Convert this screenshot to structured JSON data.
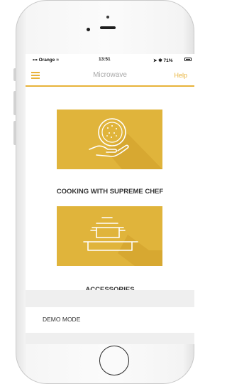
{
  "status_bar": {
    "carrier": "Orange",
    "time": "13:51",
    "battery": "71%"
  },
  "nav": {
    "title": "Microwave",
    "help_label": "Help"
  },
  "menu": {
    "items": [
      {
        "label": "COOKING WITH SUPREME CHEF",
        "icon": "plate-hand-icon"
      },
      {
        "label": "ACCESSORIES",
        "icon": "cookware-icon"
      }
    ],
    "demo_mode_label": "DEMO MODE"
  },
  "colors": {
    "accent": "#e8b33a",
    "card": "#e0b43b",
    "background": "#efefef"
  }
}
